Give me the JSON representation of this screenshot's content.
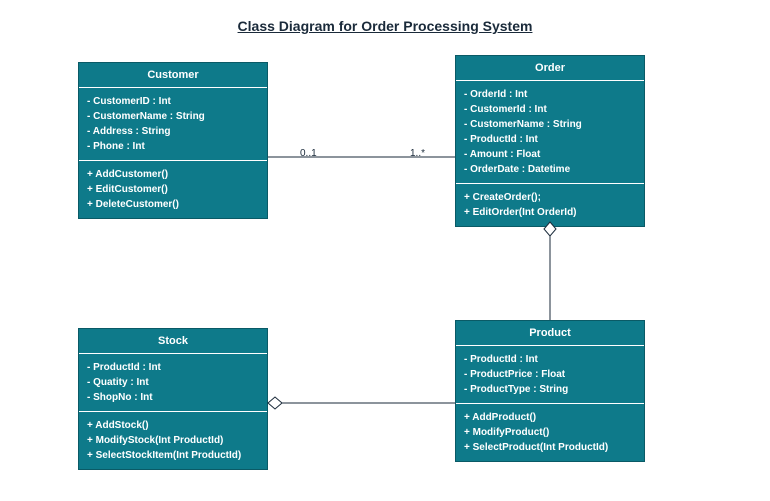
{
  "title": "Class Diagram for Order Processing System",
  "classes": {
    "customer": {
      "name": "Customer",
      "attrs": [
        "- CustomerID : Int",
        "- CustomerName : String",
        "- Address : String",
        "- Phone : Int"
      ],
      "ops": [
        "+ AddCustomer()",
        "+ EditCustomer()",
        "+ DeleteCustomer()"
      ]
    },
    "order": {
      "name": "Order",
      "attrs": [
        "- OrderId : Int",
        "- CustomerId : Int",
        "- CustomerName : String",
        "- ProductId : Int",
        "- Amount : Float",
        "- OrderDate : Datetime"
      ],
      "ops": [
        "+ CreateOrder();",
        "+ EditOrder(Int OrderId)"
      ]
    },
    "stock": {
      "name": "Stock",
      "attrs": [
        "- ProductId : Int",
        "- Quatity : Int",
        "- ShopNo : Int"
      ],
      "ops": [
        "+ AddStock()",
        "+ ModifyStock(Int ProductId)",
        "+ SelectStockItem(Int ProductId)"
      ]
    },
    "product": {
      "name": "Product",
      "attrs": [
        "- ProductId : Int",
        "- ProductPrice : Float",
        "- ProductType : String"
      ],
      "ops": [
        "+ AddProduct()",
        "+ ModifyProduct()",
        "+ SelectProduct(Int ProductId)"
      ]
    }
  },
  "multiplicities": {
    "customer_order_left": "0..1",
    "customer_order_right": "1..*"
  }
}
